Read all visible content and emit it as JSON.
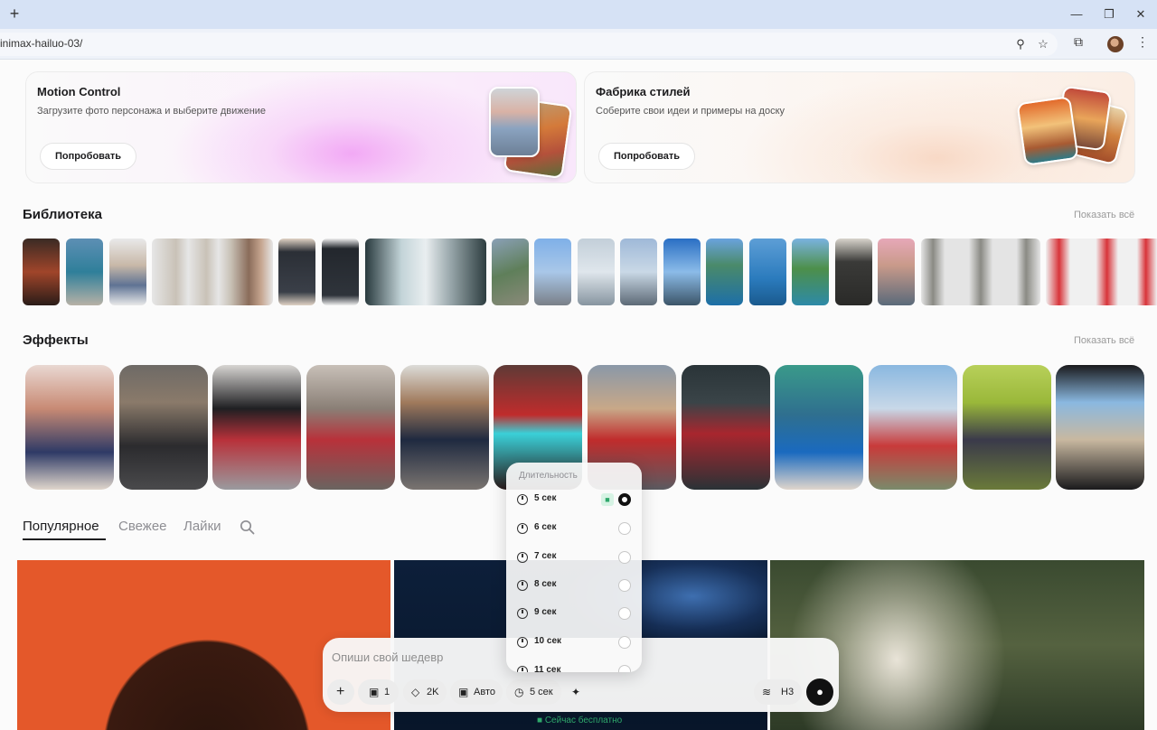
{
  "browser": {
    "new_tab_icon": "plus-icon",
    "url": "inimax-hailuo-03/",
    "window_controls": [
      "minimize",
      "restore",
      "close"
    ]
  },
  "promos": [
    {
      "title": "Motion Control",
      "subtitle": "Загрузите фото персонажа и выберите движение",
      "button": "Попробовать"
    },
    {
      "title": "Фабрика стилей",
      "subtitle": "Соберите свои идеи и примеры на доску",
      "button": "Попробовать"
    }
  ],
  "library": {
    "title": "Библиотека",
    "show_all": "Показать всё"
  },
  "effects": {
    "title": "Эффекты",
    "show_all": "Показать всё"
  },
  "tabs": {
    "popular": "Популярное",
    "fresh": "Свежее",
    "likes": "Лайки",
    "active": "Популярное"
  },
  "prompt": {
    "placeholder": "Опиши свой шедевр",
    "count": "1",
    "quality": "2K",
    "ratio": "Авто",
    "duration": "5 сек",
    "audio": "Н3",
    "free_label": "Сейчас бесплатно"
  },
  "duration_dropdown": {
    "title": "Длительность",
    "options": [
      "5 сек",
      "6 сек",
      "7 сек",
      "8 сек",
      "9 сек",
      "10 сек",
      "11 сек"
    ],
    "selected": "5 сек"
  },
  "colors": {
    "accent": "#111111",
    "free_green": "#2fa86b",
    "tab_bar": "#d6e2f5"
  }
}
